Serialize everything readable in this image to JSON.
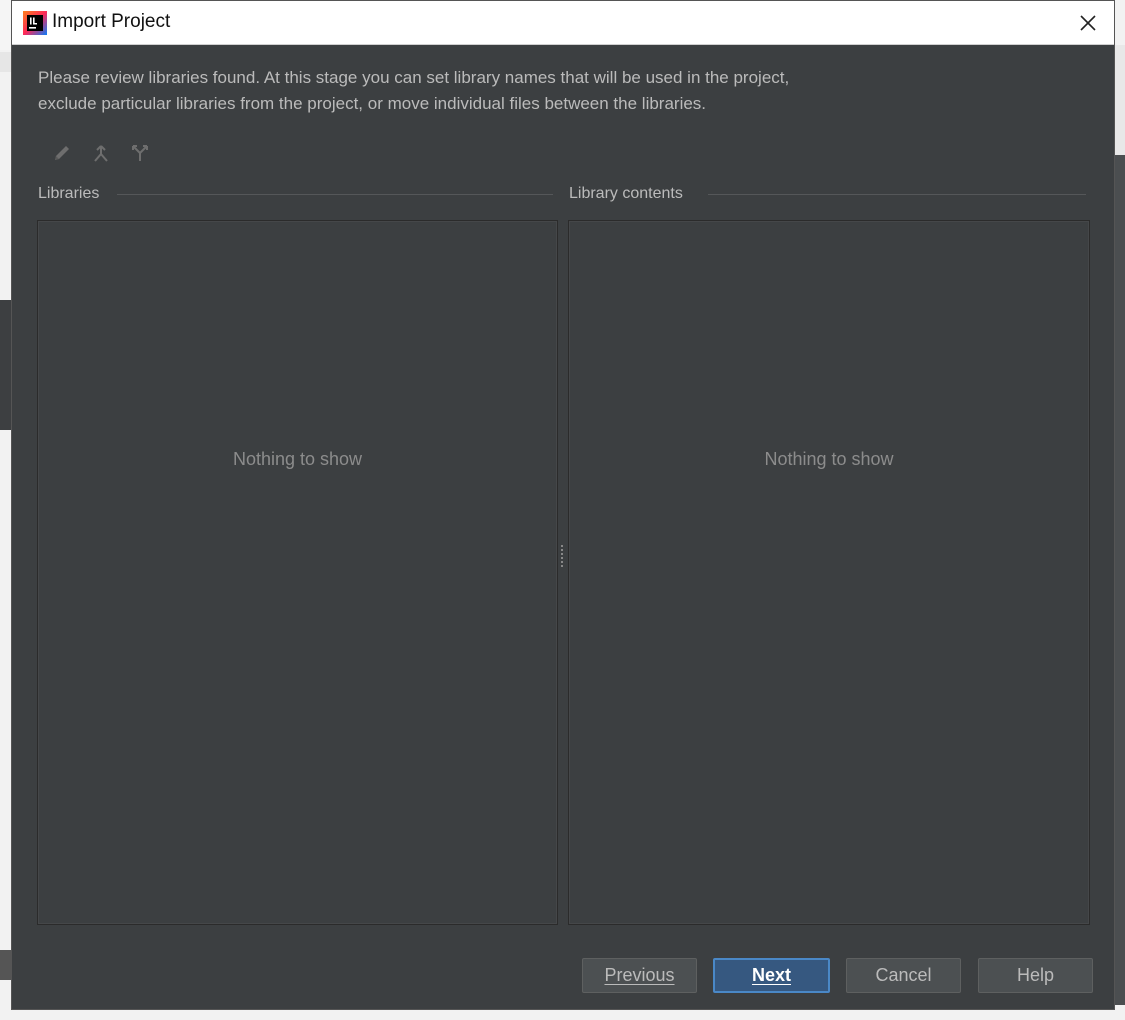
{
  "window": {
    "title": "Import Project",
    "close_icon": "close-icon"
  },
  "description": {
    "line1": "Please review libraries found. At this stage you can set library names that will be used in the project,",
    "line2": "exclude particular libraries from the project, or move individual files between the libraries."
  },
  "toolbar": {
    "items": [
      {
        "name": "rename-icon"
      },
      {
        "name": "merge-icon"
      },
      {
        "name": "split-icon"
      }
    ]
  },
  "libraries": {
    "label": "Libraries",
    "empty": "Nothing to show"
  },
  "library_contents": {
    "label": "Library contents",
    "empty": "Nothing to show"
  },
  "buttons": {
    "previous": "Previous",
    "next": "Next",
    "cancel": "Cancel",
    "help": "Help"
  },
  "colors": {
    "dialog_bg": "#3c3f41",
    "text": "#bbbbbb",
    "muted": "#8c8c8c",
    "primary_button": "#365880",
    "primary_border": "#4a88c7"
  }
}
